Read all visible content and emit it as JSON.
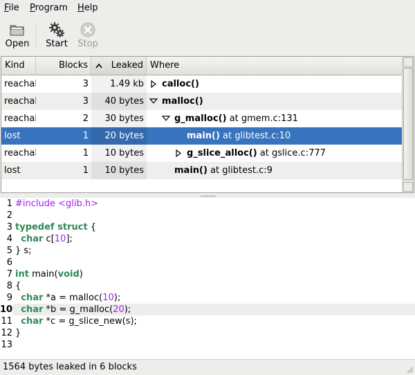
{
  "menubar": {
    "items": [
      {
        "mnemonic": "F",
        "rest": "ile"
      },
      {
        "mnemonic": "P",
        "rest": "rogram"
      },
      {
        "mnemonic": "H",
        "rest": "elp"
      }
    ]
  },
  "toolbar": {
    "open_label": "Open",
    "start_label": "Start",
    "stop_label": "Stop",
    "open_icon": "folder-icon",
    "start_icon": "gears-icon",
    "stop_icon": "stop-icon"
  },
  "tree": {
    "columns": {
      "kind": "Kind",
      "blocks": "Blocks",
      "leaked": "Leaked",
      "where": "Where"
    },
    "sort_column": "Leaked",
    "rows": [
      {
        "kind": "reachable",
        "blocks": "3",
        "leaked": "1.49 kb",
        "fn": "calloc()",
        "loc": "",
        "depth": 0,
        "expander": "collapsed"
      },
      {
        "kind": "reachable",
        "blocks": "3",
        "leaked": "40 bytes",
        "fn": "malloc()",
        "loc": "",
        "depth": 0,
        "expander": "expanded"
      },
      {
        "kind": "reachable",
        "blocks": "2",
        "leaked": "30 bytes",
        "fn": "g_malloc()",
        "loc": " at gmem.c:131",
        "depth": 1,
        "expander": "expanded"
      },
      {
        "kind": "lost",
        "blocks": "1",
        "leaked": "20 bytes",
        "fn": "main()",
        "loc": " at glibtest.c:10",
        "depth": 2,
        "expander": "none",
        "selected": true
      },
      {
        "kind": "reachable",
        "blocks": "1",
        "leaked": "10 bytes",
        "fn": "g_slice_alloc()",
        "loc": " at gslice.c:777",
        "depth": 2,
        "expander": "collapsed"
      },
      {
        "kind": "lost",
        "blocks": "1",
        "leaked": "10 bytes",
        "fn": "main()",
        "loc": " at glibtest.c:9",
        "depth": 1,
        "expander": "none"
      }
    ]
  },
  "source": {
    "current_line": 10,
    "lines": [
      {
        "n": "1",
        "tokens": [
          {
            "t": "#include <glib.h>",
            "c": "pp"
          }
        ]
      },
      {
        "n": "2",
        "tokens": []
      },
      {
        "n": "3",
        "tokens": [
          {
            "t": "typedef struct",
            "c": "kw2"
          },
          {
            "t": " {",
            "c": ""
          }
        ]
      },
      {
        "n": "4",
        "tokens": [
          {
            "t": "  ",
            "c": ""
          },
          {
            "t": "char",
            "c": "kw2"
          },
          {
            "t": " c[",
            "c": ""
          },
          {
            "t": "10",
            "c": "num"
          },
          {
            "t": "];",
            "c": ""
          }
        ]
      },
      {
        "n": "5",
        "tokens": [
          {
            "t": "} s;",
            "c": ""
          }
        ]
      },
      {
        "n": "6",
        "tokens": []
      },
      {
        "n": "7",
        "tokens": [
          {
            "t": "int",
            "c": "kw2"
          },
          {
            "t": " main(",
            "c": ""
          },
          {
            "t": "void",
            "c": "kw2"
          },
          {
            "t": ")",
            "c": ""
          }
        ]
      },
      {
        "n": "8",
        "tokens": [
          {
            "t": "{",
            "c": ""
          }
        ]
      },
      {
        "n": "9",
        "tokens": [
          {
            "t": "  ",
            "c": ""
          },
          {
            "t": "char",
            "c": "kw2"
          },
          {
            "t": " *a = malloc(",
            "c": ""
          },
          {
            "t": "10",
            "c": "num"
          },
          {
            "t": ");",
            "c": ""
          }
        ]
      },
      {
        "n": "10",
        "tokens": [
          {
            "t": "  ",
            "c": ""
          },
          {
            "t": "char",
            "c": "kw2"
          },
          {
            "t": " *b = g_malloc(",
            "c": ""
          },
          {
            "t": "20",
            "c": "num"
          },
          {
            "t": ");",
            "c": ""
          }
        ]
      },
      {
        "n": "11",
        "tokens": [
          {
            "t": "  ",
            "c": ""
          },
          {
            "t": "char",
            "c": "kw2"
          },
          {
            "t": " *c = g_slice_new(s);",
            "c": ""
          }
        ]
      },
      {
        "n": "12",
        "tokens": [
          {
            "t": "}",
            "c": ""
          }
        ]
      },
      {
        "n": "13",
        "tokens": []
      }
    ]
  },
  "statusbar": {
    "text": "1564 bytes leaked in 6 blocks"
  },
  "colors": {
    "selection": "#3873be",
    "keyword": "#2e8b57",
    "preprocessor": "#a020f0"
  }
}
